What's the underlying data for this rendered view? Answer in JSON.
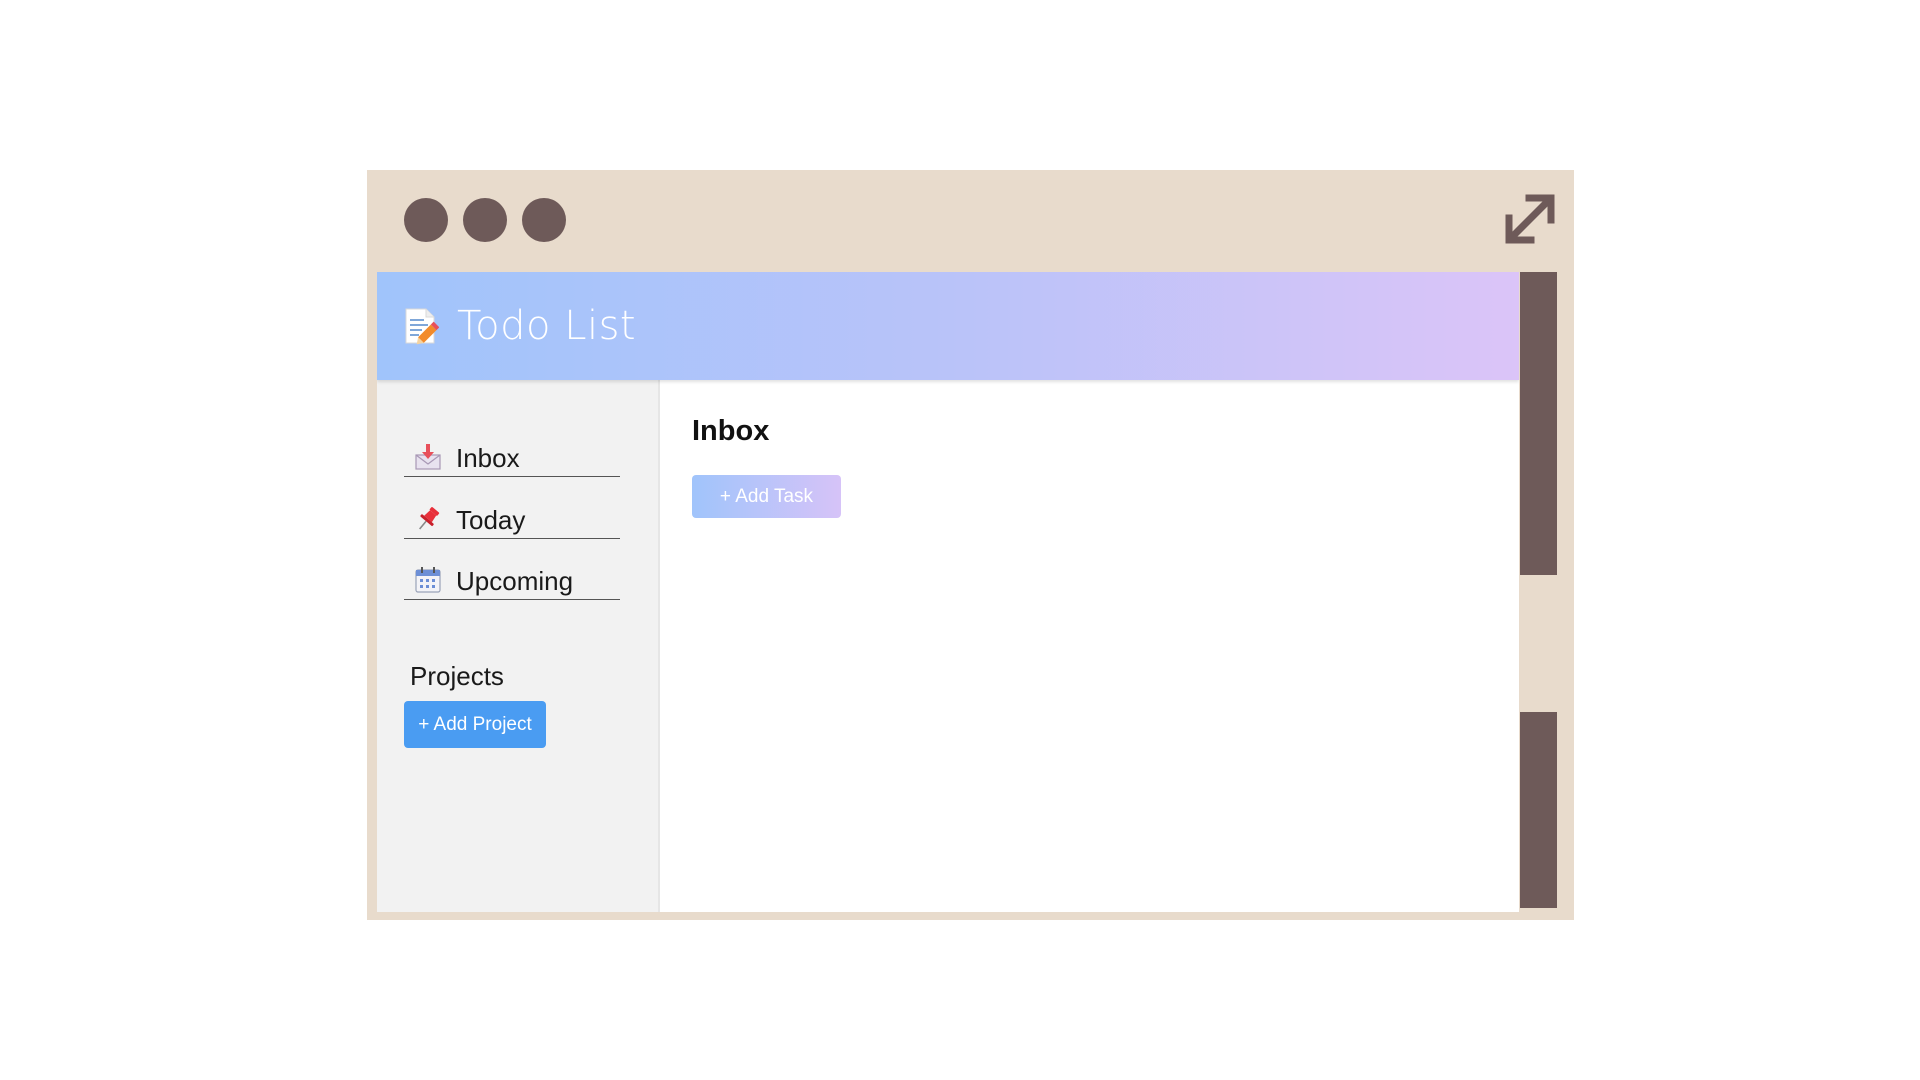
{
  "window": {
    "controls": [
      "dot",
      "dot",
      "dot"
    ],
    "expand_icon": "expand-arrows-icon",
    "frame_color": "#e8dbcc",
    "control_color": "#6e5a59"
  },
  "header": {
    "logo_icon": "memo-pencil-icon",
    "title": "Todo List",
    "gradient": [
      "#a0c4fb",
      "#dbc4f8"
    ]
  },
  "sidebar": {
    "items": [
      {
        "label": "Inbox",
        "icon": "inbox-tray-icon"
      },
      {
        "label": "Today",
        "icon": "pushpin-icon"
      },
      {
        "label": "Upcoming",
        "icon": "calendar-icon"
      }
    ],
    "projects_title": "Projects",
    "add_project_label": "+ Add Project",
    "accent": "#4a9cf2"
  },
  "main": {
    "title": "Inbox",
    "add_task_label": "+ Add Task"
  }
}
